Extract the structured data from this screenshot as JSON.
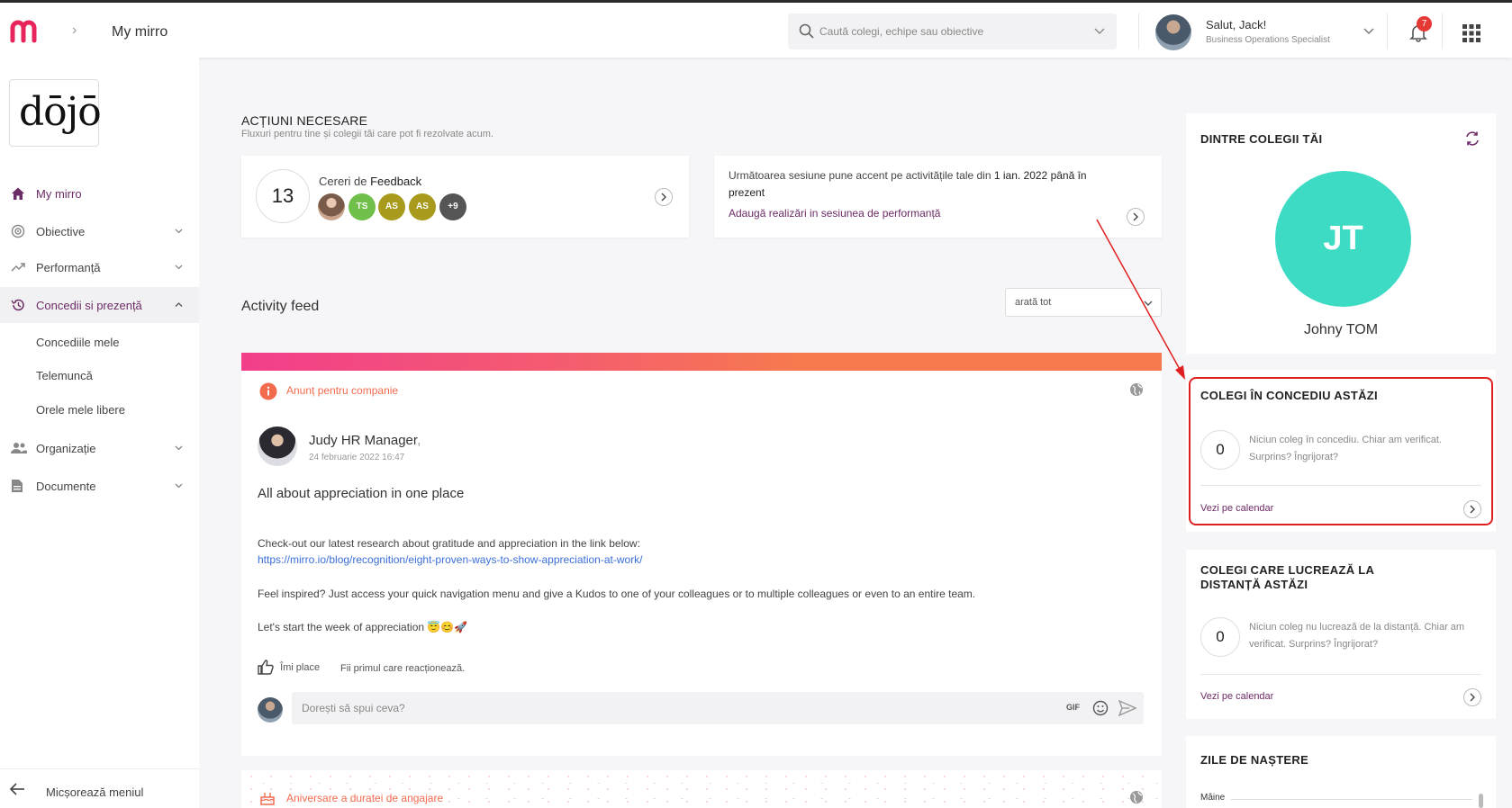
{
  "header": {
    "breadcrumb_title": "My mirro",
    "search_placeholder": "Caută colegi, echipe sau obiective",
    "greeting": "Salut, Jack!",
    "job_title": "Business Operations Specialist",
    "notifications_count": "7"
  },
  "sidebar": {
    "logo_text": "dōjō",
    "items": [
      {
        "label": "My mirro",
        "icon": "home-icon"
      },
      {
        "label": "Obiective",
        "icon": "target-icon"
      },
      {
        "label": "Performanță",
        "icon": "trend-icon"
      },
      {
        "label": "Concedii si prezență",
        "icon": "history-icon"
      },
      {
        "label": "Organizație",
        "icon": "people-icon"
      },
      {
        "label": "Documente",
        "icon": "document-icon"
      }
    ],
    "subitems": [
      "Concediile mele",
      "Telemuncă",
      "Orele mele libere"
    ],
    "collapse_label": "Micșorează meniul"
  },
  "actions": {
    "title": "ACȚIUNI NECESARE",
    "subtitle": "Fluxuri pentru tine și colegii tăi care pot fi rezolvate acum.",
    "feedback": {
      "count": "13",
      "label_prefix": "Cereri de",
      "label_bold": "Feedback",
      "avatars": [
        {
          "initials": "",
          "color": "#c9a58c"
        },
        {
          "initials": "TS",
          "color": "#6fbf4a"
        },
        {
          "initials": "AS",
          "color": "#a89a1c"
        },
        {
          "initials": "AS",
          "color": "#a89a1c"
        },
        {
          "initials": "+9",
          "color": "#555555"
        }
      ]
    },
    "session": {
      "text_prefix": "Următoarea sesiune pune accent pe activitățile tale din ",
      "text_bold": "1 ian. 2022 până în prezent",
      "link": "Adaugă realizări in sesiunea de performanță"
    }
  },
  "feed": {
    "title": "Activity feed",
    "filter": "arată tot",
    "post": {
      "tag": "Anunț pentru companie",
      "author": "Judy HR Manager",
      "author_suffix": ",",
      "date": "24 februarie 2022 16:47",
      "title": "All about appreciation in one place",
      "p1": "Check-out our latest research about gratitude and appreciation in the link below:",
      "link": "https://mirro.io/blog/recognition/eight-proven-ways-to-show-appreciation-at-work/",
      "p2": "Feel inspired? Just access your quick navigation menu and give a Kudos to one of your colleagues or to multiple colleagues or even to an entire team.",
      "p3": "Let's start the week of appreciation 😇😊🚀",
      "like_label": "Îmi place",
      "like_hint": "Fii primul care reacționează.",
      "comment_placeholder": "Dorești să spui ceva?",
      "gif_label": "GIF"
    },
    "post2_tag": "Aniversare a duratei de angajare"
  },
  "right": {
    "colleagues": {
      "title": "DINTRE COLEGII TĂI",
      "initials": "JT",
      "name": "Johny TOM",
      "avatar_color": "#3ddbc4"
    },
    "leave": {
      "title": "COLEGI ÎN CONCEDIU ASTĂZI",
      "count": "0",
      "text": "Niciun coleg în concediu. Chiar am verificat. Surprins? Îngrijorat?",
      "link": "Vezi pe calendar"
    },
    "remote": {
      "title_line1": "COLEGI CARE LUCREAZĂ LA",
      "title_line2": "DISTANȚĂ ASTĂZI",
      "count": "0",
      "text": "Niciun coleg nu lucrează de la distanță. Chiar am verificat. Surprins? Îngrijorat?",
      "link": "Vezi pe calendar"
    },
    "birthdays": {
      "title": "ZILE DE NAȘTERE",
      "first_label": "Mâine"
    }
  },
  "colors": {
    "brand": "#e8245c",
    "accent_purple": "#6d2b66",
    "annotation_red": "#e02020"
  }
}
